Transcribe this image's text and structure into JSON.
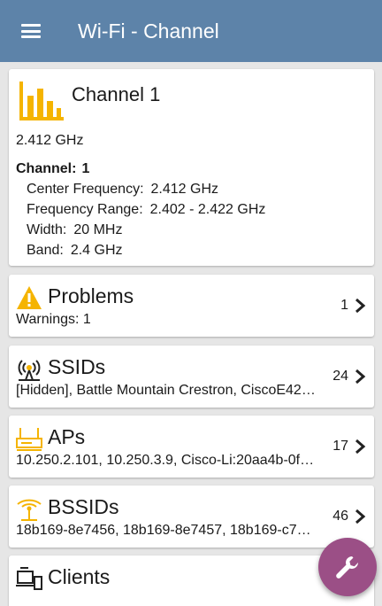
{
  "app": {
    "title": "Wi-Fi - Channel"
  },
  "channel_card": {
    "title": "Channel 1",
    "frequency": "2.412 GHz",
    "channel_label": "Channel:",
    "channel_value": "1",
    "details": [
      {
        "label": "Center Frequency:",
        "value": "2.412 GHz"
      },
      {
        "label": "Frequency Range:",
        "value": "2.402 - 2.422 GHz"
      },
      {
        "label": "Width:",
        "value": "20 MHz"
      },
      {
        "label": "Band:",
        "value": "2.4 GHz"
      }
    ]
  },
  "problems": {
    "title": "Problems",
    "subtitle": "Warnings:  1",
    "count": "1"
  },
  "ssids": {
    "title": "SSIDs",
    "subtitle": "[Hidden], Battle Mountain Crestron, CiscoE42…",
    "count": "24"
  },
  "aps": {
    "title": "APs",
    "subtitle": "10.250.2.101, 10.250.3.9, Cisco-Li:20aa4b-0f…",
    "count": "17"
  },
  "bssids": {
    "title": "BSSIDs",
    "subtitle": "18b169-8e7456, 18b169-8e7457, 18b169-c7…",
    "count": "46"
  },
  "clients": {
    "title": "Clients"
  },
  "colors": {
    "appbar": "#5d83a9",
    "accent": "#f5b400",
    "fab": "#9b4f86"
  },
  "icons": {
    "menu": "menu-icon",
    "channel": "bar-chart-icon",
    "problems": "warning-icon",
    "ssids": "wifi-tower-icon",
    "aps": "access-point-icon",
    "bssids": "antenna-icon",
    "clients": "client-devices-icon",
    "fab": "wrench-icon"
  }
}
